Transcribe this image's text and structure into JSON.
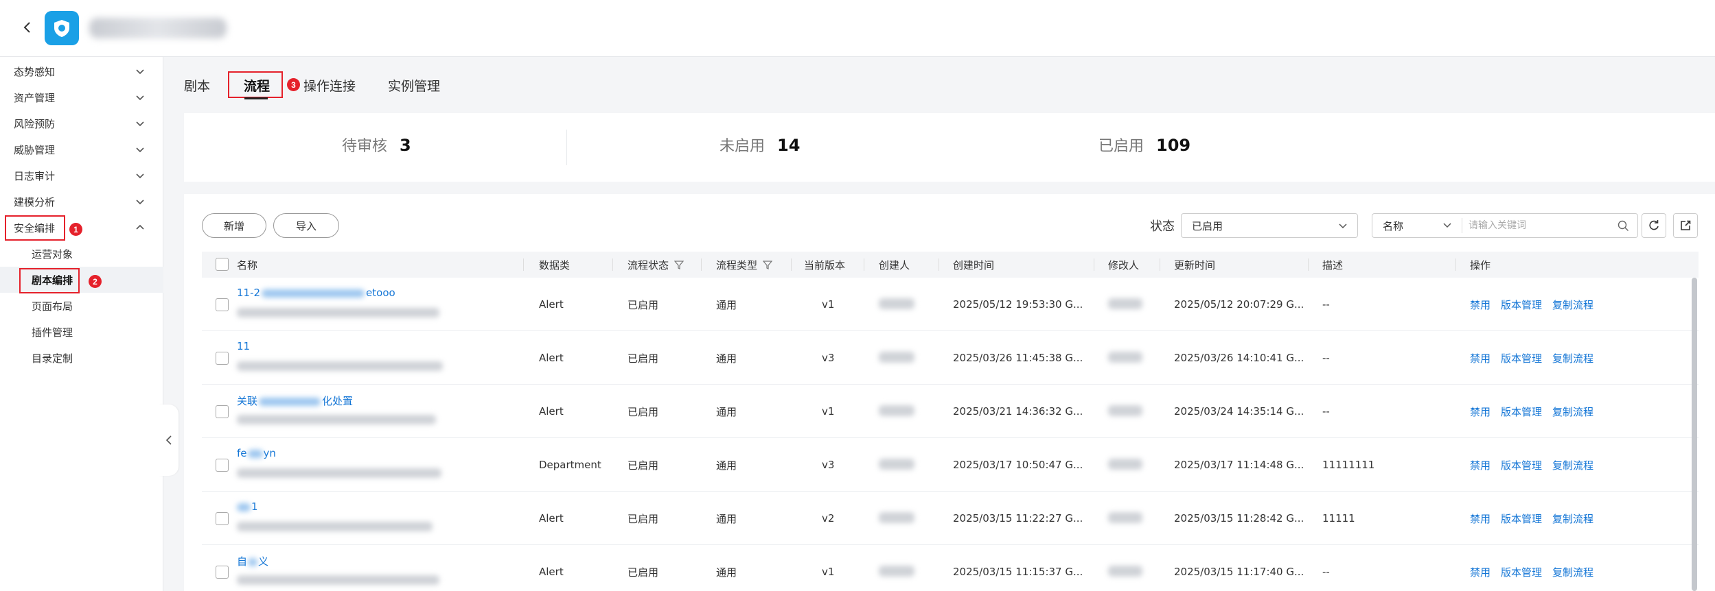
{
  "sidebar": {
    "items": [
      {
        "label": "态势感知"
      },
      {
        "label": "资产管理"
      },
      {
        "label": "风险预防"
      },
      {
        "label": "威胁管理"
      },
      {
        "label": "日志审计"
      },
      {
        "label": "建模分析"
      },
      {
        "label": "安全编排"
      }
    ],
    "sub_items": [
      {
        "label": "运营对象"
      },
      {
        "label": "剧本编排"
      },
      {
        "label": "页面布局"
      },
      {
        "label": "插件管理"
      },
      {
        "label": "目录定制"
      }
    ],
    "badges": {
      "step1": "1",
      "step2": "2"
    }
  },
  "tabs": [
    {
      "label": "剧本"
    },
    {
      "label": "流程"
    },
    {
      "label": "操作连接"
    },
    {
      "label": "实例管理"
    }
  ],
  "tab_badge": "3",
  "stats": [
    {
      "label": "待审核",
      "value": "3"
    },
    {
      "label": "未启用",
      "value": "14"
    },
    {
      "label": "已启用",
      "value": "109"
    }
  ],
  "toolbar": {
    "add_label": "新增",
    "import_label": "导入",
    "status_label": "状态",
    "status_value": "已启用",
    "search_field": "名称",
    "search_placeholder": "请输入关键词"
  },
  "table": {
    "headers": [
      "名称",
      "数据类",
      "流程状态",
      "流程类型",
      "当前版本",
      "创建人",
      "创建时间",
      "修改人",
      "更新时间",
      "描述",
      "操作"
    ],
    "actions": [
      "禁用",
      "版本管理",
      "复制流程"
    ],
    "rows": [
      {
        "name": "11-2",
        "name_tail": "etooo",
        "data_class": "Alert",
        "status": "已启用",
        "type": "通用",
        "version": "v1",
        "created": "2025/05/12 19:53:30 G...",
        "updated": "2025/05/12 20:07:29 G...",
        "desc": "--"
      },
      {
        "name": "11",
        "name_tail": "",
        "data_class": "Alert",
        "status": "已启用",
        "type": "通用",
        "version": "v3",
        "created": "2025/03/26 11:45:38 G...",
        "updated": "2025/03/26 14:10:41 G...",
        "desc": "--"
      },
      {
        "name": "关联",
        "name_tail": "化处置",
        "data_class": "Alert",
        "status": "已启用",
        "type": "通用",
        "version": "v1",
        "created": "2025/03/21 14:36:32 G...",
        "updated": "2025/03/24 14:35:14 G...",
        "desc": "--"
      },
      {
        "name": "fe",
        "name_tail": "yn",
        "data_class": "Department",
        "status": "已启用",
        "type": "通用",
        "version": "v3",
        "created": "2025/03/17 10:50:47 G...",
        "updated": "2025/03/17 11:14:48 G...",
        "desc": "11111111"
      },
      {
        "name": "",
        "name_tail": "1",
        "data_class": "Alert",
        "status": "已启用",
        "type": "通用",
        "version": "v2",
        "created": "2025/03/15 11:22:27 G...",
        "updated": "2025/03/15 11:28:42 G...",
        "desc": "11111"
      },
      {
        "name": "自",
        "name_tail": "义",
        "data_class": "Alert",
        "status": "已启用",
        "type": "通用",
        "version": "v1",
        "created": "2025/03/15 11:15:37 G...",
        "updated": "2025/03/15 11:17:40 G...",
        "desc": "--"
      }
    ]
  },
  "colors": {
    "accent": "#1476d6",
    "highlight": "#e5212b",
    "logo": "#1aa0e6"
  }
}
